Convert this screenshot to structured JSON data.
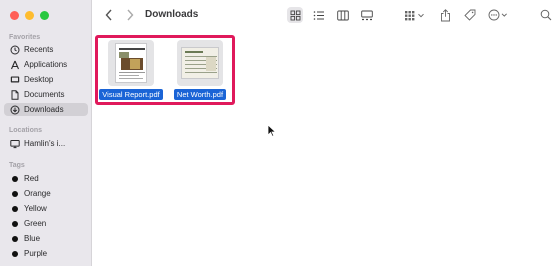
{
  "window": {
    "title": "Downloads"
  },
  "sidebar": {
    "favorites_title": "Favorites",
    "favorites": [
      {
        "label": "Recents",
        "icon": "clock-icon"
      },
      {
        "label": "Applications",
        "icon": "applications-icon"
      },
      {
        "label": "Desktop",
        "icon": "desktop-icon"
      },
      {
        "label": "Documents",
        "icon": "document-icon"
      },
      {
        "label": "Downloads",
        "icon": "download-icon",
        "active": true
      }
    ],
    "locations_title": "Locations",
    "locations": [
      {
        "label": "Hamlin’s i...",
        "icon": "computer-icon"
      }
    ],
    "tags_title": "Tags",
    "tags": [
      {
        "label": "Red"
      },
      {
        "label": "Orange"
      },
      {
        "label": "Yellow"
      },
      {
        "label": "Green"
      },
      {
        "label": "Blue"
      },
      {
        "label": "Purple"
      }
    ]
  },
  "files": [
    {
      "name": "Visual Report.pdf",
      "thumbnail": "report-thumbnail"
    },
    {
      "name": "Net Worth.pdf",
      "thumbnail": "networth-thumbnail"
    }
  ],
  "colors": {
    "accent": "#1a64d6",
    "highlight_box": "#e0195b"
  }
}
